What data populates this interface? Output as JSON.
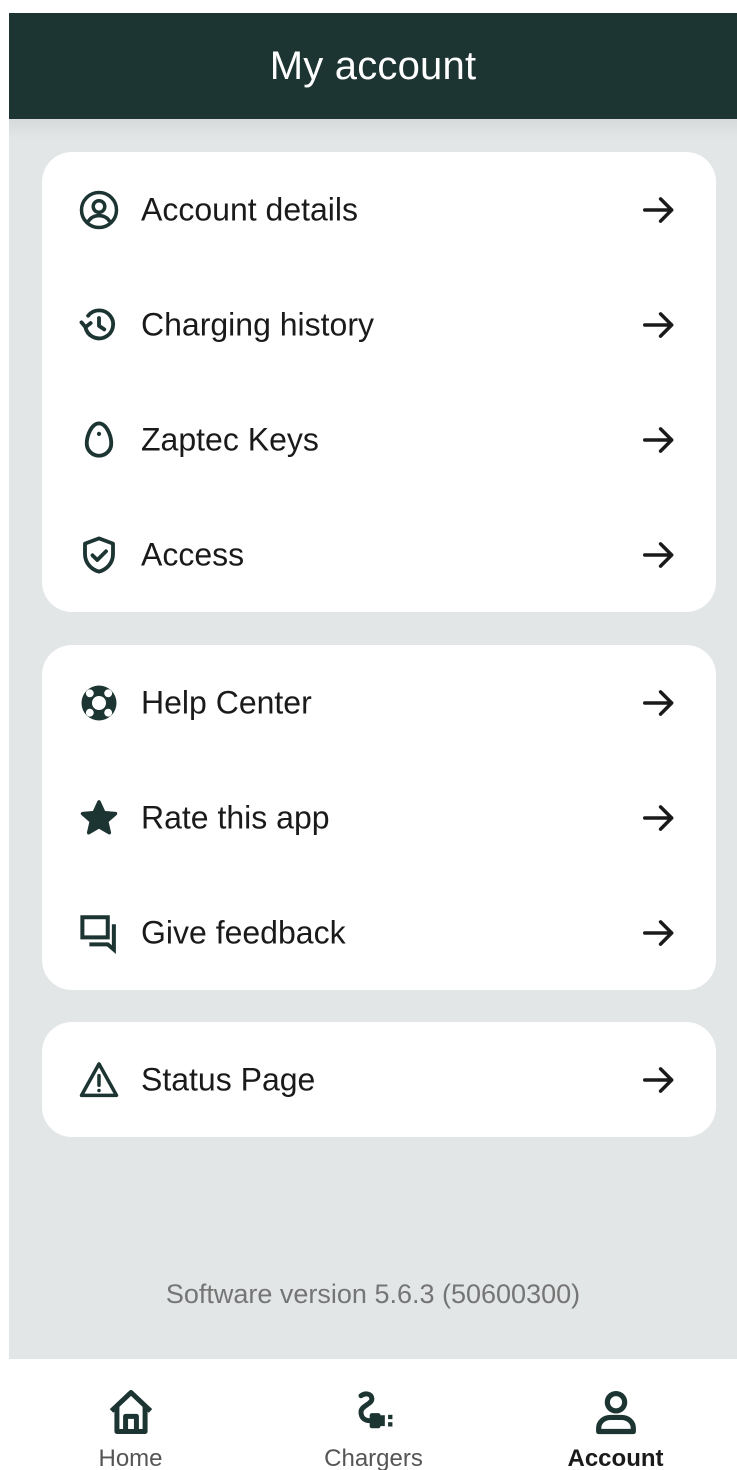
{
  "header": {
    "title": "My account"
  },
  "sections": [
    {
      "items": [
        {
          "label": "Account details",
          "icon": "account-circle-icon"
        },
        {
          "label": "Charging history",
          "icon": "history-icon"
        },
        {
          "label": "Zaptec Keys",
          "icon": "key-fob-icon"
        },
        {
          "label": "Access",
          "icon": "shield-check-icon"
        }
      ]
    },
    {
      "items": [
        {
          "label": "Help Center",
          "icon": "lifebuoy-icon"
        },
        {
          "label": "Rate this app",
          "icon": "star-icon"
        },
        {
          "label": "Give feedback",
          "icon": "feedback-icon"
        }
      ]
    },
    {
      "items": [
        {
          "label": "Status Page",
          "icon": "warning-icon"
        }
      ]
    }
  ],
  "footer": {
    "version_text": "Software version 5.6.3 (50600300)"
  },
  "tabbar": {
    "items": [
      {
        "label": "Home",
        "icon": "home-icon",
        "active": false
      },
      {
        "label": "Chargers",
        "icon": "charger-plug-icon",
        "active": false
      },
      {
        "label": "Account",
        "icon": "person-icon",
        "active": true
      }
    ]
  },
  "colors": {
    "header_bg": "#1d3532",
    "page_bg": "#e3e6e7",
    "icon_color": "#1d3532",
    "text": "#1a1a1a",
    "muted_text": "#757575"
  }
}
